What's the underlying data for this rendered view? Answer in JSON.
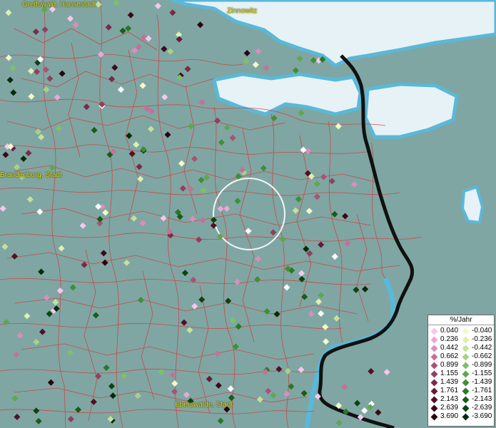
{
  "map": {
    "cities": [
      {
        "name": "Greifswald, Hansestadt"
      },
      {
        "name": "Zinnowitz"
      },
      {
        "name": "Brandenburg, Stadt"
      },
      {
        "name": "Eberswalde, Stadt"
      }
    ],
    "colors": {
      "land": "#7fa6a3",
      "water": "#e6f2f6",
      "coast": "#5ab8d8",
      "boundaries": "#d33a3a",
      "border_line": "#111111",
      "label": "#e8e020"
    }
  },
  "legend": {
    "title": "%/Jahr",
    "positive": [
      {
        "label": "0.040",
        "color": "#f7c6ec"
      },
      {
        "label": "0.236",
        "color": "#eaa8d6"
      },
      {
        "label": "0.442",
        "color": "#d98fbb"
      },
      {
        "label": "0.662",
        "color": "#c4709a"
      },
      {
        "label": "0.899",
        "color": "#aa5276"
      },
      {
        "label": "1.155",
        "color": "#923f5f"
      },
      {
        "label": "1.439",
        "color": "#7a2a48"
      },
      {
        "label": "1.761",
        "color": "#651c36"
      },
      {
        "label": "2.143",
        "color": "#501026"
      },
      {
        "label": "2.639",
        "color": "#3c0818"
      },
      {
        "label": "3.690",
        "color": "#2a020e"
      }
    ],
    "negative": [
      {
        "label": "-0.040",
        "color": "#f4fac8"
      },
      {
        "label": "-0.236",
        "color": "#dcf0b0"
      },
      {
        "label": "-0.442",
        "color": "#c2e39a"
      },
      {
        "label": "-0.662",
        "color": "#a4d484"
      },
      {
        "label": "-0.899",
        "color": "#7fc067"
      },
      {
        "label": "-1.155",
        "color": "#5ea84d"
      },
      {
        "label": "-1.439",
        "color": "#3f8f36"
      },
      {
        "label": "-1.761",
        "color": "#2a7727"
      },
      {
        "label": "-2.143",
        "color": "#175d18"
      },
      {
        "label": "-2.639",
        "color": "#0b4410"
      },
      {
        "label": "-3.690",
        "color": "#052b06"
      }
    ]
  }
}
